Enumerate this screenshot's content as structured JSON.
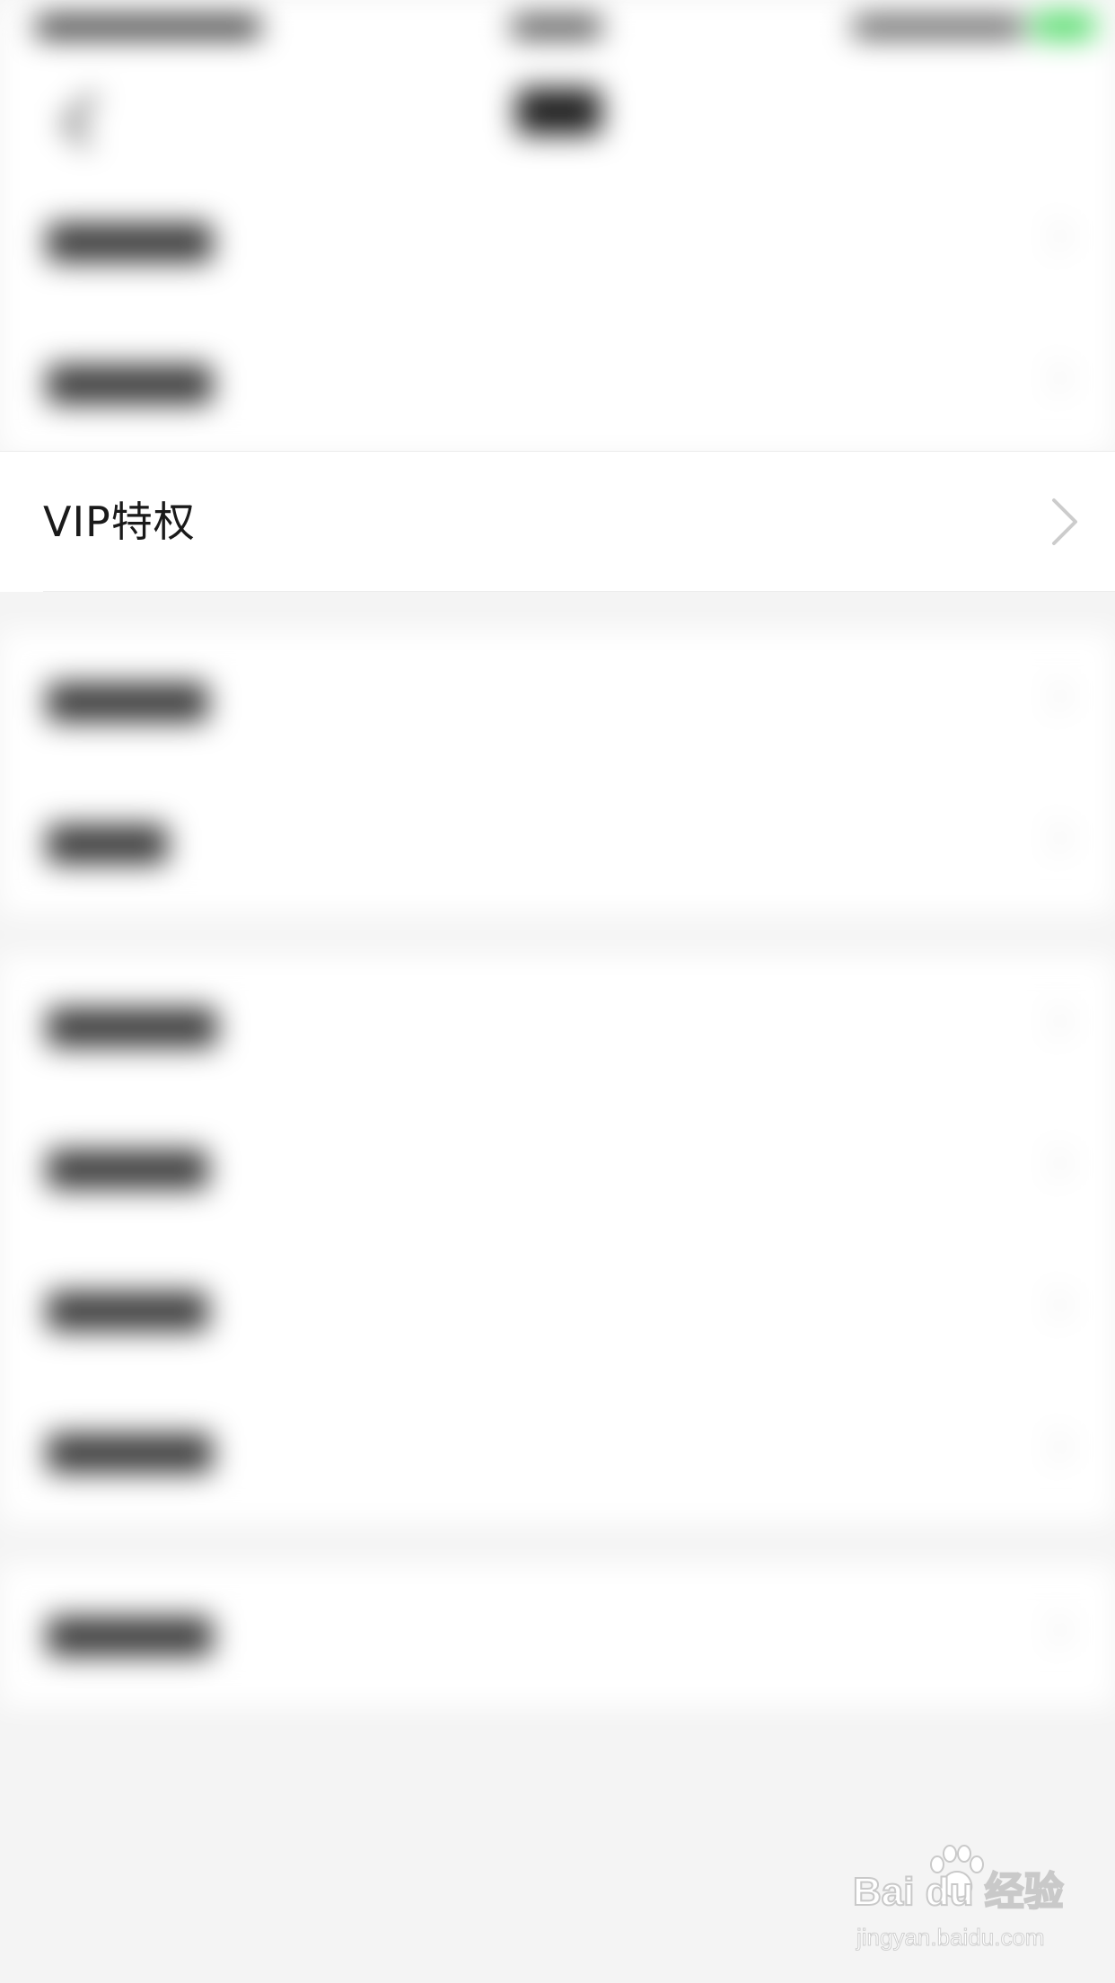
{
  "vip_item": {
    "label": "VIP特权"
  },
  "watermark": {
    "brand": "Bai du 经验",
    "url": "jingyan.baidu.com"
  },
  "colors": {
    "background": "#f4f4f4",
    "row_background": "#ffffff",
    "primary_text": "#1a1a1a",
    "chevron": "#cccccc",
    "status_battery": "#4cd964"
  },
  "icons": {
    "row_chevron": "chevron-right-icon",
    "nav_back": "back-arrow-icon",
    "watermark_logo": "paw-icon"
  }
}
